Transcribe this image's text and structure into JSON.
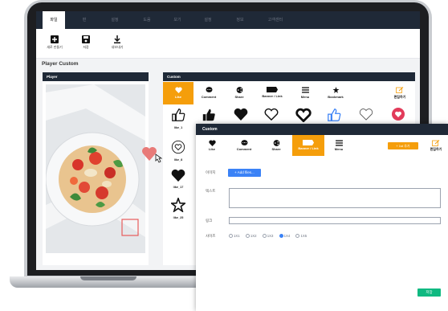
{
  "tabs": [
    "파일",
    "편",
    "설정",
    "도움",
    "보기",
    "설정",
    "정보",
    "고객센터"
  ],
  "toolbar": {
    "new_label": "새로 만들기",
    "save_label": "저장",
    "export_label": "내보내기"
  },
  "section_title": "Player Custom",
  "player": {
    "header": "Player"
  },
  "custom": {
    "header": "Custom",
    "categories": [
      "Like",
      "Comment",
      "Share",
      "Banner / Link",
      "Menu",
      "Bookmark"
    ],
    "edit_label": "편집하기",
    "grid_labels": [
      "like_1",
      "like_8",
      "like_17",
      "like_25"
    ]
  },
  "floating": {
    "header": "Custom",
    "categories": [
      "Like",
      "Comment",
      "Share",
      "Banner / Link",
      "Menu"
    ],
    "add_button": "+ 1st 추가",
    "edit_label": "편집하기",
    "image_label": "이미지",
    "add_files": "+ Add files...",
    "text_label": "텍스트",
    "link_label": "링크",
    "size_label": "사이즈",
    "sizes": [
      "1X1",
      "1X2",
      "1X3",
      "1X4",
      "1X5"
    ],
    "selected_size": "1X4",
    "save_button": "저장"
  },
  "colors": {
    "accent_orange": "#f59e0b",
    "dark_header": "#1f2937",
    "blue": "#3b82f6",
    "green": "#10b981",
    "heart_red": "#e85c5c"
  }
}
